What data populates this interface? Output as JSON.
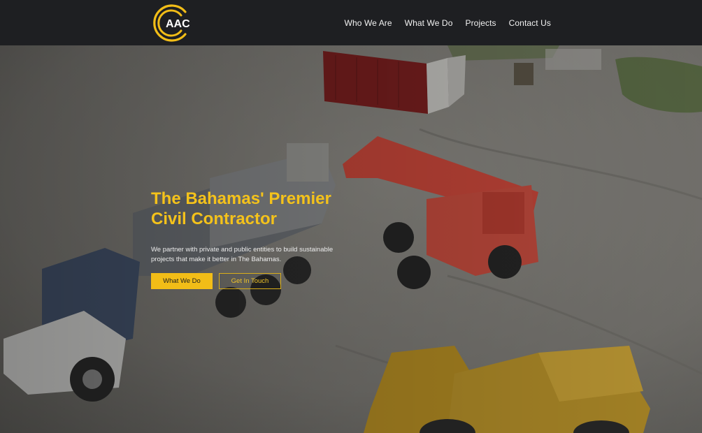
{
  "brand": {
    "logo_text": "AAC",
    "accent_color": "#f2bd17"
  },
  "nav": {
    "items": [
      "Who We Are",
      "What We Do",
      "Projects",
      "Contact Us"
    ]
  },
  "hero": {
    "title_line1": "The Bahamas' Premier",
    "title_line2": "Civil Contractor",
    "subtitle": "We partner with private and public entities to build sustainable projects that make it better in The Bahamas.",
    "primary_button": "What We Do",
    "secondary_button": "Get In Touch",
    "background_scene": "aerial photo of construction site with dump truck, telehandler and front loaders"
  }
}
